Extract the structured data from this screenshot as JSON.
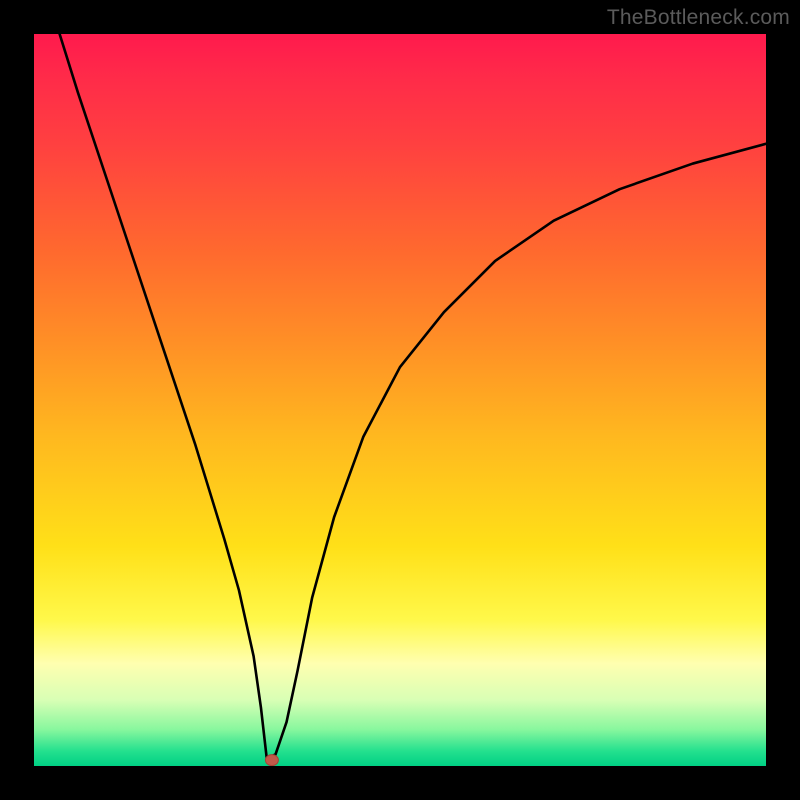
{
  "watermark": "TheBottleneck.com",
  "colors": {
    "frame": "#000000",
    "curve": "#000000",
    "marker_fill": "#c05a4a",
    "marker_stroke": "#a64437"
  },
  "chart_data": {
    "type": "line",
    "title": "",
    "xlabel": "",
    "ylabel": "",
    "xlim": [
      0,
      100
    ],
    "ylim": [
      0,
      100
    ],
    "grid": false,
    "legend": false,
    "series": [
      {
        "name": "curve",
        "x": [
          3.5,
          6,
          10,
          14,
          18,
          22,
          26,
          28,
          30,
          31,
          31.8,
          33,
          34.5,
          36,
          38,
          41,
          45,
          50,
          56,
          63,
          71,
          80,
          90,
          100
        ],
        "y": [
          100,
          92,
          80,
          68,
          56,
          44,
          31,
          24,
          15,
          8,
          1,
          1.6,
          6,
          13,
          23,
          34,
          45,
          54.5,
          62,
          69,
          74.5,
          78.8,
          82.3,
          85
        ]
      }
    ],
    "markers": [
      {
        "name": "dot",
        "x": 32.5,
        "y": 0.8
      }
    ],
    "background_gradient": {
      "direction": "vertical",
      "stops": [
        {
          "pos": 0.0,
          "color": "#ff1a4d"
        },
        {
          "pos": 0.3,
          "color": "#ff6a2e"
        },
        {
          "pos": 0.55,
          "color": "#ffb81f"
        },
        {
          "pos": 0.8,
          "color": "#fff84a"
        },
        {
          "pos": 0.95,
          "color": "#88f79e"
        },
        {
          "pos": 1.0,
          "color": "#00d084"
        }
      ]
    }
  }
}
